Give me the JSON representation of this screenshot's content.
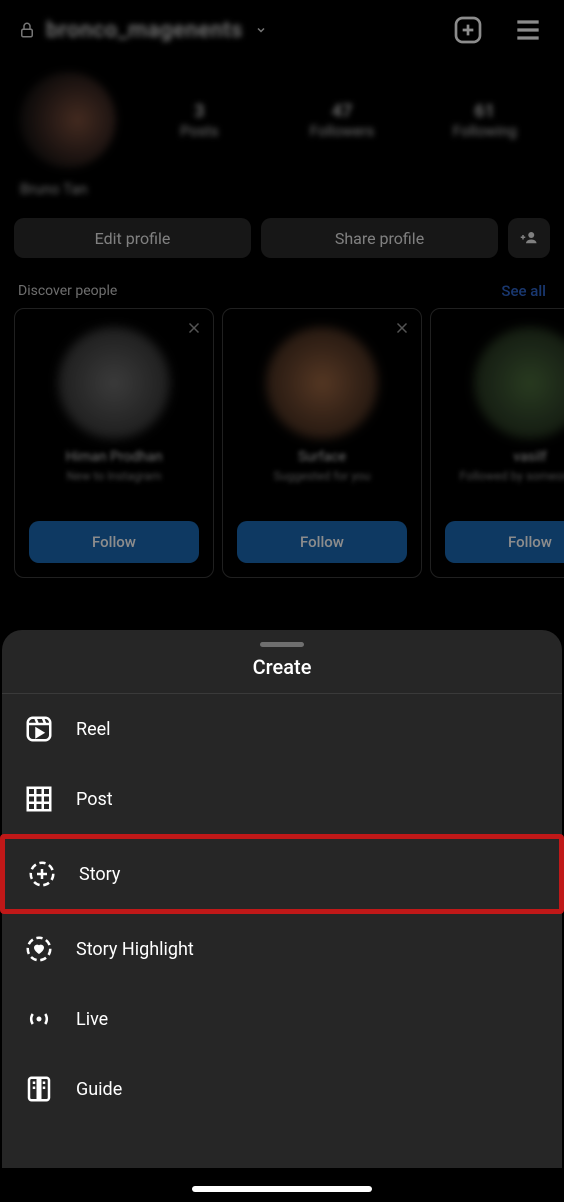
{
  "header": {
    "username": "bronco_magenents",
    "lock": true
  },
  "profile": {
    "display_name": "Bruno Tan",
    "stats": {
      "posts_num": "3",
      "posts_label": "Posts",
      "followers_num": "47",
      "followers_label": "Followers",
      "following_num": "61",
      "following_label": "Following"
    }
  },
  "buttons": {
    "edit_profile": "Edit profile",
    "share_profile": "Share profile"
  },
  "discover": {
    "label": "Discover people",
    "see_all": "See all",
    "cards": [
      {
        "name": "Himan Prodhan",
        "sub": "New to Instagram",
        "follow": "Follow"
      },
      {
        "name": "Surface",
        "sub": "Suggested for you",
        "follow": "Follow"
      },
      {
        "name": "vasilf",
        "sub": "Followed by someone else",
        "follow": "Follow"
      }
    ]
  },
  "sheet": {
    "title": "Create",
    "items": [
      {
        "key": "reel",
        "label": "Reel"
      },
      {
        "key": "post",
        "label": "Post"
      },
      {
        "key": "story",
        "label": "Story"
      },
      {
        "key": "story_highlight",
        "label": "Story Highlight"
      },
      {
        "key": "live",
        "label": "Live"
      },
      {
        "key": "guide",
        "label": "Guide"
      }
    ]
  },
  "colors": {
    "sheet_bg": "#262626",
    "follow_btn": "#1a68b3",
    "see_all": "#2e64c9",
    "highlight_border": "#c01818"
  }
}
